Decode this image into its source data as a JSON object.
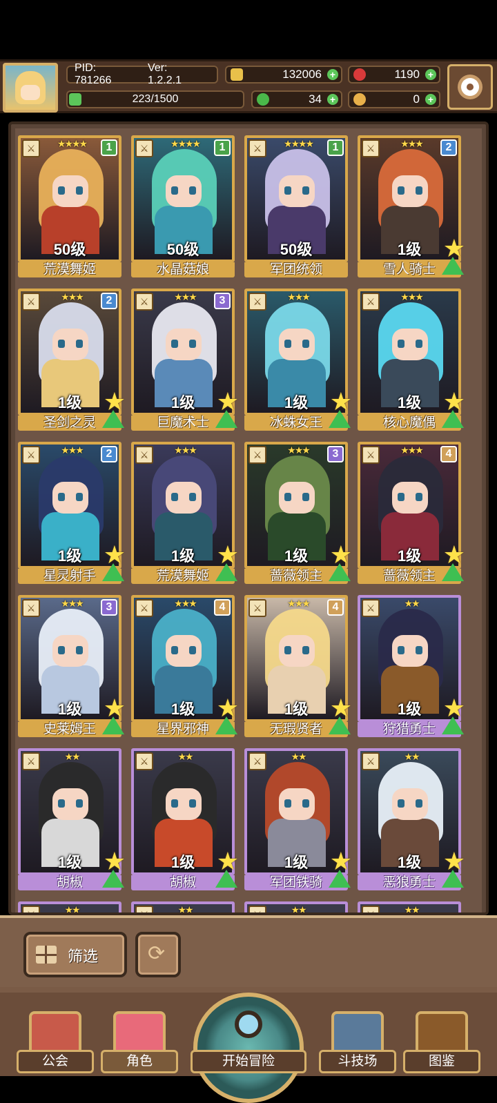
{
  "header": {
    "pid": "PID: 781266",
    "version": "Ver: 1.2.2.1",
    "gold": "132006",
    "gems": "1190",
    "exp": "223/1500",
    "clover": "34",
    "meat": "0"
  },
  "cards": [
    {
      "name": "荒漠舞姬",
      "level": "50级",
      "stars": "★★★★",
      "rank": "1",
      "frame": "gold",
      "hair": "#e8b05a",
      "body": "#b8402a",
      "bg": "#8a5a3a"
    },
    {
      "name": "水晶菇娘",
      "level": "50级",
      "stars": "★★★★",
      "rank": "1",
      "frame": "gold",
      "hair": "#5ad0b8",
      "body": "#3a9ab0",
      "bg": "#2e6a78"
    },
    {
      "name": "军团统领",
      "level": "50级",
      "stars": "★★★★",
      "rank": "1",
      "frame": "gold",
      "hair": "#c8c0e8",
      "body": "#4a3a6a",
      "bg": "#3a4a6a"
    },
    {
      "name": "雪人骑士",
      "level": "1级",
      "stars": "★★★",
      "rank": "2",
      "frame": "gold",
      "hair": "#d86a3a",
      "body": "#4a3a32",
      "bg": "#5a3a2a"
    },
    {
      "name": "圣剑之灵",
      "level": "1级",
      "stars": "★★★",
      "rank": "2",
      "frame": "gold",
      "hair": "#d8dcec",
      "body": "#e8c87a",
      "bg": "#5a4a3a"
    },
    {
      "name": "巨魔术士",
      "level": "1级",
      "stars": "★★★",
      "rank": "3",
      "frame": "gold",
      "hair": "#e8e8f0",
      "body": "#5a8ab8",
      "bg": "#3a3a4a"
    },
    {
      "name": "冰蛛女王",
      "level": "1级",
      "stars": "★★★",
      "rank": "",
      "frame": "gold",
      "hair": "#7ad8e8",
      "body": "#3a8aa8",
      "bg": "#2a5a6a"
    },
    {
      "name": "核心魔偶",
      "level": "1级",
      "stars": "★★★",
      "rank": "",
      "frame": "gold",
      "hair": "#5ad8f0",
      "body": "#3a4a5a",
      "bg": "#2a3a4a"
    },
    {
      "name": "星灵射手",
      "level": "1级",
      "stars": "★★★",
      "rank": "2",
      "frame": "gold",
      "hair": "#2a3a6a",
      "body": "#3ab0c8",
      "bg": "#2a4a6a"
    },
    {
      "name": "荒漠舞姬",
      "level": "1级",
      "stars": "★★★",
      "rank": "",
      "frame": "gold",
      "hair": "#4a4a7a",
      "body": "#2a5a6a",
      "bg": "#3a3a5a"
    },
    {
      "name": "蔷薇领主",
      "level": "1级",
      "stars": "★★★",
      "rank": "3",
      "frame": "gold",
      "hair": "#6a8a4a",
      "body": "#2a4a2a",
      "bg": "#2a3a2a"
    },
    {
      "name": "蔷薇领主",
      "level": "1级",
      "stars": "★★★",
      "rank": "4",
      "frame": "gold",
      "hair": "#2a2a3a",
      "body": "#8a2a3a",
      "bg": "#4a2a3a"
    },
    {
      "name": "史莱姆王",
      "level": "1级",
      "stars": "★★★",
      "rank": "3",
      "frame": "gold",
      "hair": "#e8eef8",
      "body": "#b8c8e0",
      "bg": "#5a6a8a"
    },
    {
      "name": "星界邪神",
      "level": "1级",
      "stars": "★★★",
      "rank": "4",
      "frame": "gold",
      "hair": "#4ab0c8",
      "body": "#3a7a9a",
      "bg": "#2a4a6a"
    },
    {
      "name": "无瑕贤者",
      "level": "1级",
      "stars": "★★★",
      "rank": "4",
      "frame": "gold",
      "hair": "#f4d88a",
      "body": "#e8d0b0",
      "bg": "#c8b8a8"
    },
    {
      "name": "狩猎勇士",
      "level": "1级",
      "stars": "★★",
      "rank": "",
      "frame": "purple",
      "hair": "#2a2a4a",
      "body": "#8a5a2a",
      "bg": "#3a4a6a"
    },
    {
      "name": "胡椒",
      "level": "1级",
      "stars": "★★",
      "rank": "",
      "frame": "purple",
      "hair": "#2a2a2a",
      "body": "#d8d8d8",
      "bg": "#3a3a4a"
    },
    {
      "name": "胡椒",
      "level": "1级",
      "stars": "★★",
      "rank": "",
      "frame": "purple",
      "hair": "#2a2a2a",
      "body": "#c84a2a",
      "bg": "#3a3a4a"
    },
    {
      "name": "军团铁骑",
      "level": "1级",
      "stars": "★★",
      "rank": "",
      "frame": "purple",
      "hair": "#b84a2a",
      "body": "#8a8a9a",
      "bg": "#3a3a4a"
    },
    {
      "name": "恶狼勇士",
      "level": "1级",
      "stars": "★★",
      "rank": "",
      "frame": "purple",
      "hair": "#e8f0f8",
      "body": "#6a4a3a",
      "bg": "#3a4a5a"
    }
  ],
  "partial_cards": [
    {
      "stars": "★★"
    },
    {
      "stars": "★★"
    },
    {
      "stars": "★★"
    },
    {
      "stars": "★★"
    }
  ],
  "filter": {
    "label": "筛选"
  },
  "nav": {
    "guild": "公会",
    "character": "角色",
    "adventure": "开始冒险",
    "arena": "斗技场",
    "codex": "图鉴"
  }
}
